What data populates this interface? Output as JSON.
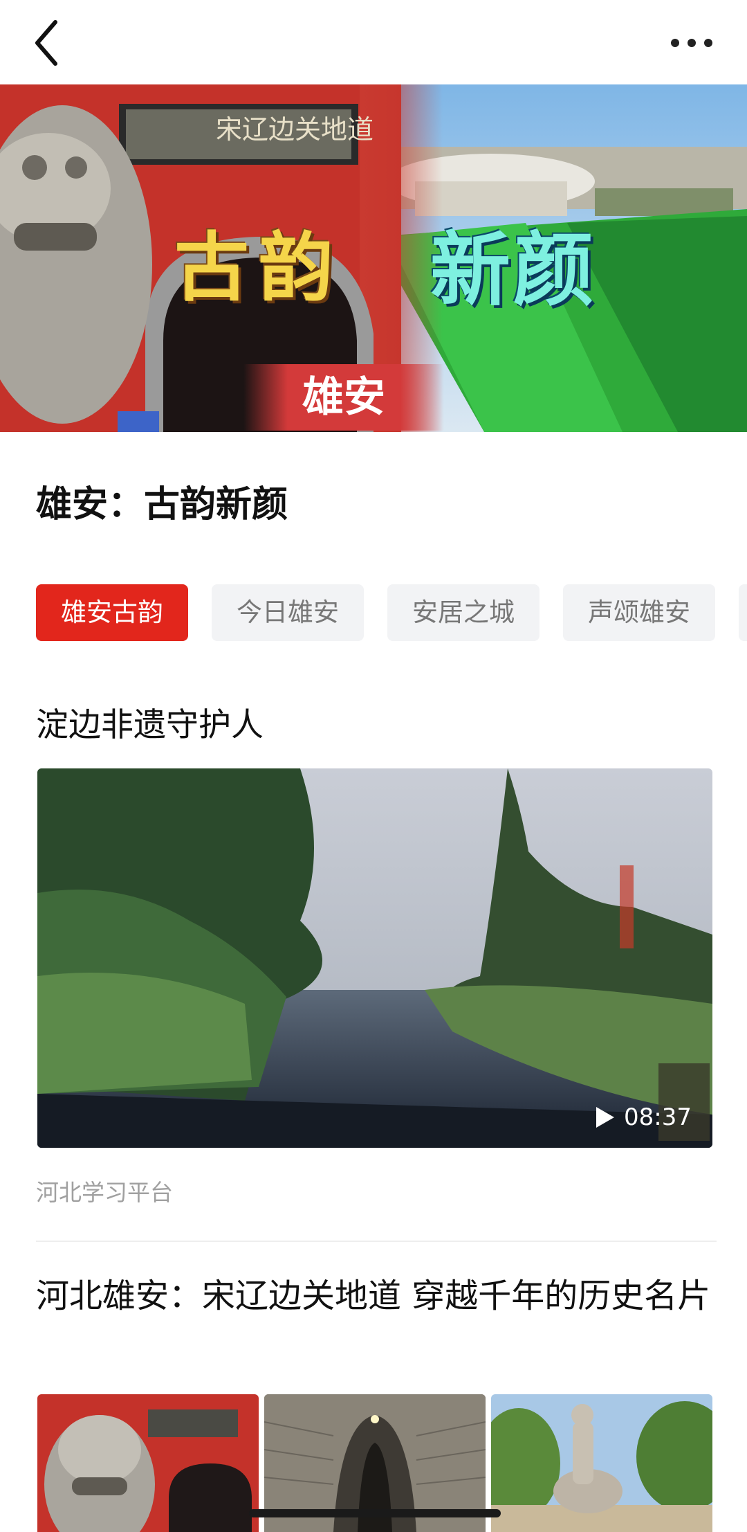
{
  "nav": {
    "back_icon": "chevron-left-icon",
    "more_icon": "more-horizontal-icon"
  },
  "hero": {
    "title_old": "古韵",
    "title_new": "新颜",
    "badge": "雄安",
    "gate_plaque": "宋辽边关地道"
  },
  "page_title": "雄安：古韵新颜",
  "tabs": [
    {
      "label": "雄安古韵",
      "active": true
    },
    {
      "label": "今日雄安",
      "active": false
    },
    {
      "label": "安居之城",
      "active": false
    },
    {
      "label": "声颂雄安",
      "active": false
    }
  ],
  "articles": [
    {
      "title": "淀边非遗守护人",
      "video_duration": "08:37",
      "source": "河北学习平台"
    },
    {
      "title": "河北雄安：宋辽边关地道 穿越千年的历史名片"
    }
  ],
  "colors": {
    "accent": "#e2261c",
    "tab_bg": "#f2f3f5",
    "muted_text": "#a0a0a0"
  }
}
